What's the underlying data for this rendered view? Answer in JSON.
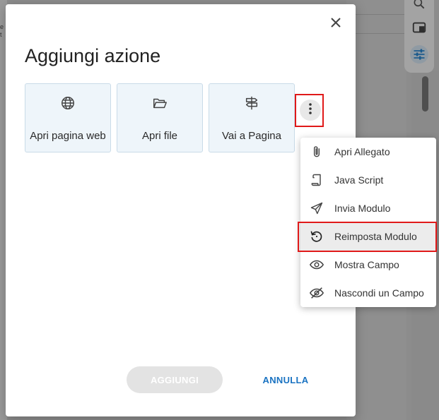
{
  "background": {
    "left_text": [
      "e",
      "t"
    ]
  },
  "toolbar": {
    "icons": [
      "search-icon",
      "panel-icon",
      "sliders-icon"
    ],
    "accent": "#1a73c2"
  },
  "dialog": {
    "title": "Aggiungi azione",
    "actions": [
      {
        "label": "Apri pagina web",
        "icon": "globe-icon"
      },
      {
        "label": "Apri file",
        "icon": "folder-open-icon"
      },
      {
        "label": "Vai a Pagina",
        "icon": "signpost-icon"
      }
    ],
    "add_label": "AGGIUNGI",
    "cancel_label": "ANNULLA"
  },
  "menu": {
    "items": [
      {
        "label": "Apri Allegato",
        "icon": "paperclip-icon"
      },
      {
        "label": "Java Script",
        "icon": "scroll-icon"
      },
      {
        "label": "Invia Modulo",
        "icon": "send-icon"
      },
      {
        "label": "Reimposta Modulo",
        "icon": "reset-icon",
        "highlighted": true
      },
      {
        "label": "Mostra Campo",
        "icon": "eye-icon"
      },
      {
        "label": "Nascondi un Campo",
        "icon": "eye-off-icon"
      }
    ]
  },
  "colors": {
    "highlight_border": "#e01919",
    "card_bg": "#eef5fa",
    "primary": "#1a73c2"
  }
}
